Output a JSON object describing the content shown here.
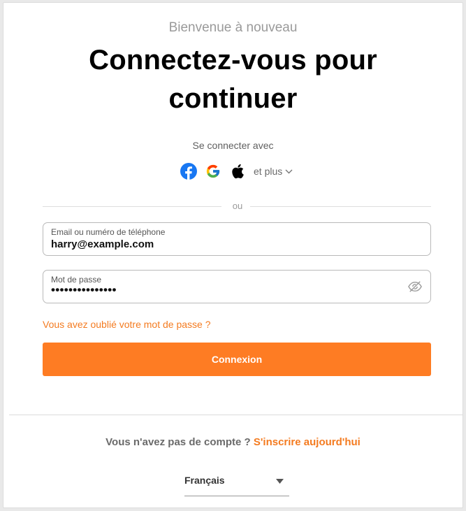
{
  "header": {
    "welcome": "Bienvenue à nouveau",
    "title_line1": "Connectez-vous pour",
    "title_line2": "continuer"
  },
  "social": {
    "label": "Se connecter avec",
    "providers": [
      {
        "name": "facebook-icon",
        "color": "#1877f2"
      },
      {
        "name": "google-icon",
        "color": "#4285f4"
      },
      {
        "name": "apple-icon",
        "color": "#000000"
      }
    ],
    "more_label": "et plus"
  },
  "divider": {
    "or": "ou"
  },
  "form": {
    "email_label": "Email ou numéro de téléphone",
    "email_value": "harry@example.com",
    "password_label": "Mot de passe",
    "password_value": "•••••••••••••••",
    "forgot_link": "Vous avez oublié votre mot de passe ?",
    "submit": "Connexion"
  },
  "footer": {
    "no_account": "Vous n'avez pas de compte ?",
    "signup_link": "S'inscrire aujourd'hui",
    "language": "Français"
  },
  "colors": {
    "accent": "#fe7c23",
    "link": "#f47b20"
  }
}
